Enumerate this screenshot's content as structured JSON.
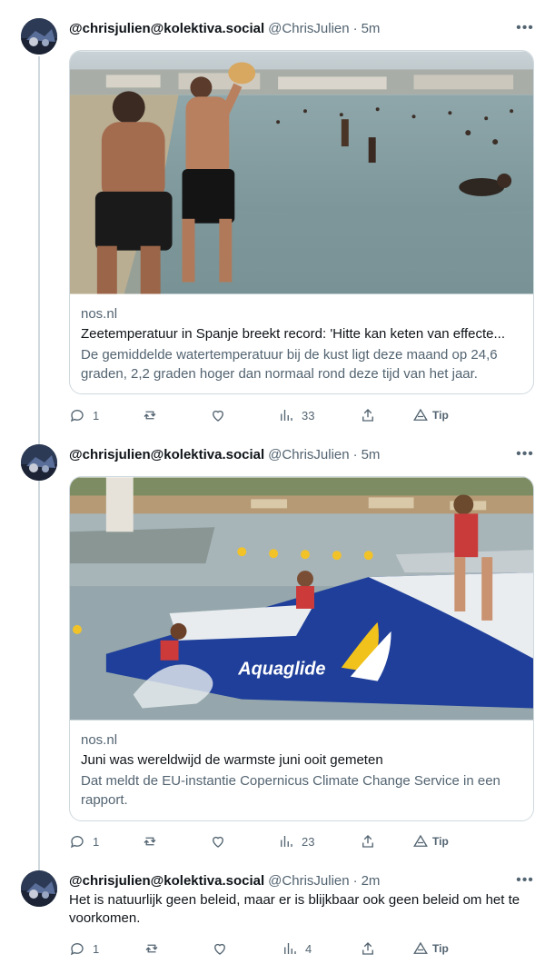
{
  "tweets": [
    {
      "name": "@chrisjulien@kolektiva.social",
      "handle": "@ChrisJulien",
      "dot": "·",
      "time": "5m",
      "more": "•••",
      "card": {
        "image_icon": "beach-photo",
        "domain": "nos.nl",
        "title": "Zeetemperatuur in Spanje breekt record: 'Hitte kan keten van effecte...",
        "description": "De gemiddelde watertemperatuur bij de kust ligt deze maand op 24,6 graden, 2,2 graden hoger dan normaal rond deze tijd van het jaar."
      },
      "actions": {
        "replies": "1",
        "reposts": "",
        "likes": "",
        "views": "33",
        "tip": "Tip"
      }
    },
    {
      "name": "@chrisjulien@kolektiva.social",
      "handle": "@ChrisJulien",
      "dot": "·",
      "time": "5m",
      "more": "•••",
      "card": {
        "image_icon": "water-slide-photo",
        "domain": "nos.nl",
        "title": "Juni was wereldwijd de warmste juni ooit gemeten",
        "description": "Dat meldt de EU-instantie Copernicus Climate Change Service in een rapport."
      },
      "actions": {
        "replies": "1",
        "reposts": "",
        "likes": "",
        "views": "23",
        "tip": "Tip"
      }
    },
    {
      "name": "@chrisjulien@kolektiva.social",
      "handle": "@ChrisJulien",
      "dot": "·",
      "time": "2m",
      "more": "•••",
      "text": "Het is natuurlijk geen beleid, maar er is blijkbaar ook geen beleid om het te voorkomen.",
      "actions": {
        "replies": "1",
        "reposts": "",
        "likes": "",
        "views": "4",
        "tip": "Tip"
      }
    }
  ],
  "colors": {
    "text": "#0f1419",
    "secondary": "#536471",
    "border": "#cfd9de"
  }
}
